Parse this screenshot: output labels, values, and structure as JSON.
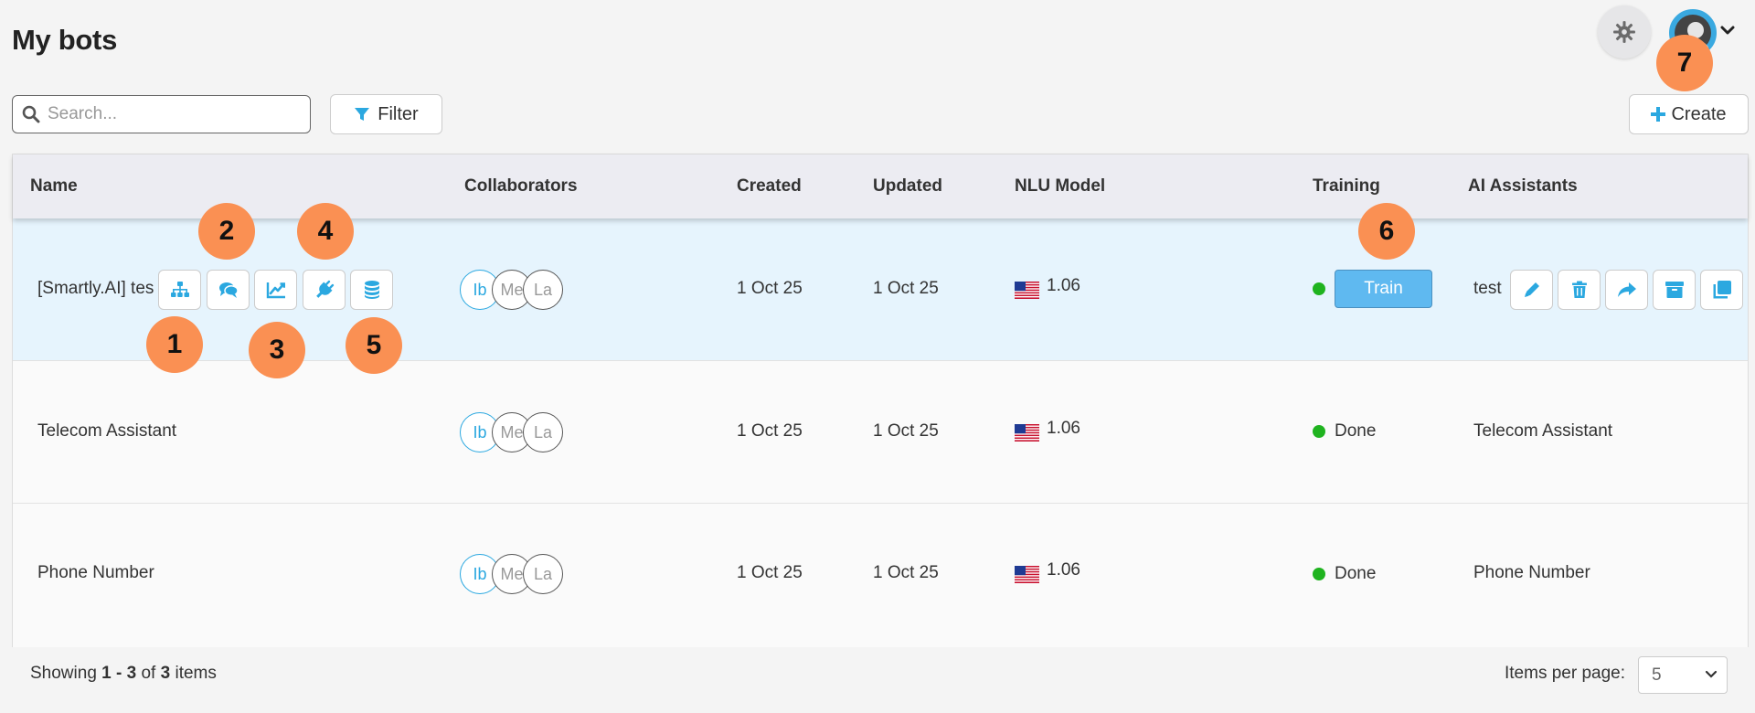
{
  "header": {
    "title": "My bots",
    "theme_icon": "gear-icon",
    "avatar_icon": "user-avatar-icon"
  },
  "toolbar": {
    "search_placeholder": "Search...",
    "search_value": "",
    "filter_label": "Filter",
    "create_label": "Create"
  },
  "table": {
    "columns": [
      "Name",
      "Collaborators",
      "Created",
      "Updated",
      "NLU Model",
      "Training",
      "AI Assistants"
    ],
    "rows": [
      {
        "name": "[Smartly.AI] tes",
        "collaborators": [
          "Ib",
          "Me",
          "La"
        ],
        "created": "1 Oct 25",
        "updated": "1 Oct 25",
        "nlu_model": "1.06",
        "training_status": "",
        "train_label": "Train",
        "ai_assistant": "test"
      },
      {
        "name": "Telecom Assistant",
        "collaborators": [
          "Ib",
          "Me",
          "La"
        ],
        "created": "1 Oct 25",
        "updated": "1 Oct 25",
        "nlu_model": "1.06",
        "training_status": "Done",
        "ai_assistant": "Telecom Assistant"
      },
      {
        "name": "Phone Number",
        "collaborators": [
          "Ib",
          "Me",
          "La"
        ],
        "created": "1 Oct 25",
        "updated": "1 Oct 25",
        "nlu_model": "1.06",
        "training_status": "Done",
        "ai_assistant": "Phone Number"
      }
    ]
  },
  "footer": {
    "showing_prefix": "Showing ",
    "showing_range": "1 - 3",
    "showing_of": " of ",
    "showing_total": "3",
    "showing_suffix": " items",
    "items_per_page_label": "Items per page:",
    "items_per_page_value": "5"
  },
  "annotations": [
    "1",
    "2",
    "3",
    "4",
    "5",
    "6",
    "7"
  ],
  "colors": {
    "accent": "#2ba8e0",
    "train_button": "#5fb9f0",
    "status_done": "#1fb31f",
    "annotation_badge": "#fa9053",
    "selected_row": "#e6f4fd"
  }
}
